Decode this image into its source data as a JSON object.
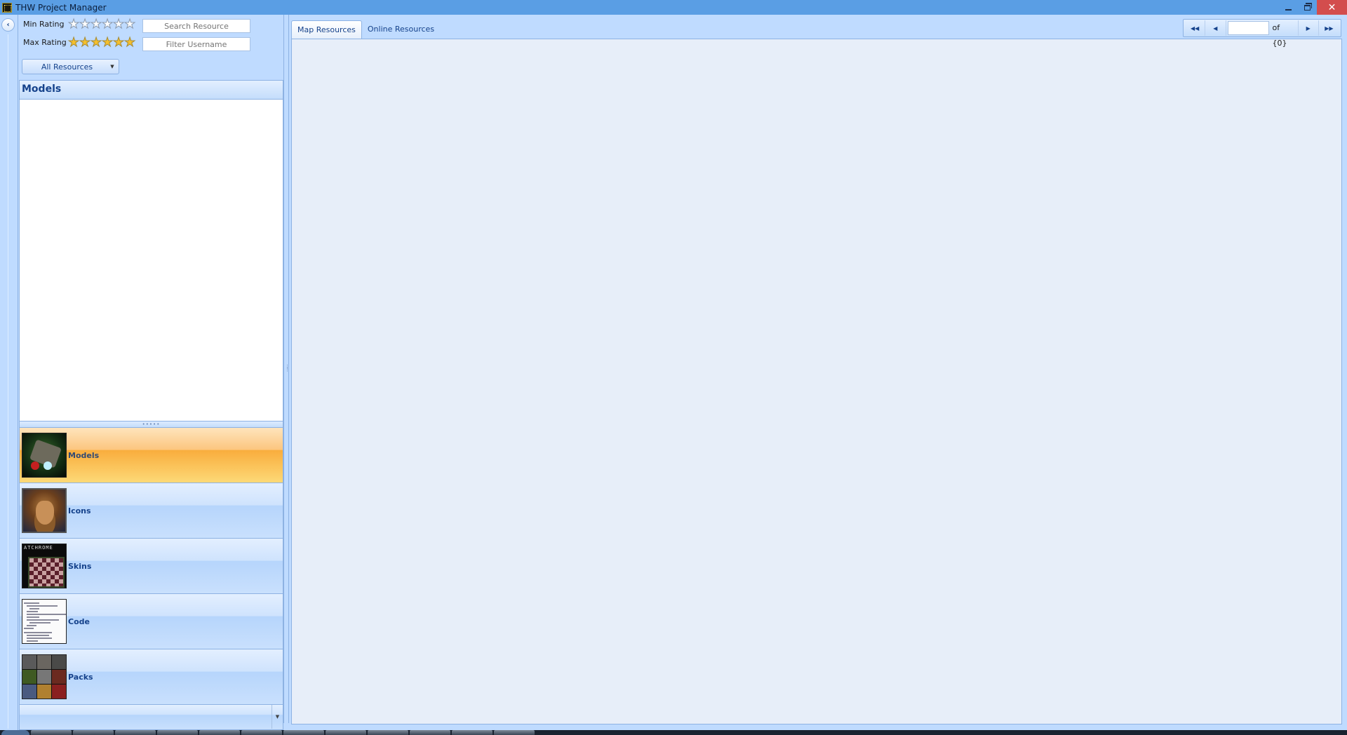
{
  "window": {
    "title": "THW Project Manager",
    "icon": "app-icon",
    "controls": [
      "minimize",
      "restore",
      "close"
    ]
  },
  "collapse_button": {
    "icon": "chevron-left-icon",
    "glyph": "‹"
  },
  "filters": {
    "min_rating_label": "Min Rating",
    "max_rating_label": "Max Rating",
    "min_rating_value": 0,
    "max_rating_value": 6,
    "star_count": 6,
    "search_placeholder": "Search Resource",
    "username_placeholder": "Filter Username",
    "category_dropdown": {
      "selected": "All Resources",
      "arrow": "▼"
    }
  },
  "panel": {
    "title": "Models",
    "splitter_grip": "•••••"
  },
  "nav": {
    "items": [
      {
        "label": "Models",
        "thumb": "models-thumbnail",
        "active": true
      },
      {
        "label": "Icons",
        "thumb": "icons-thumbnail",
        "active": false
      },
      {
        "label": "Skins",
        "thumb": "skins-thumbnail",
        "active": false
      },
      {
        "label": "Code",
        "thumb": "code-thumbnail",
        "active": false
      },
      {
        "label": "Packs",
        "thumb": "packs-thumbnail",
        "active": false
      }
    ],
    "overflow_arrow": "▼"
  },
  "tabs": [
    {
      "label": "Map Resources",
      "active": true
    },
    {
      "label": "Online Resources",
      "active": false
    }
  ],
  "pager": {
    "first": "◀◀",
    "prev": "◀",
    "current_page": "",
    "of_label": "of {0}",
    "next": "▶",
    "last": "▶▶"
  },
  "colors": {
    "titlebar": "#5a9ee4",
    "active_nav": "#f9ad3d",
    "panel_bg": "#bfdbff",
    "content_bg": "#e7eef9",
    "close": "#d34d4d"
  }
}
